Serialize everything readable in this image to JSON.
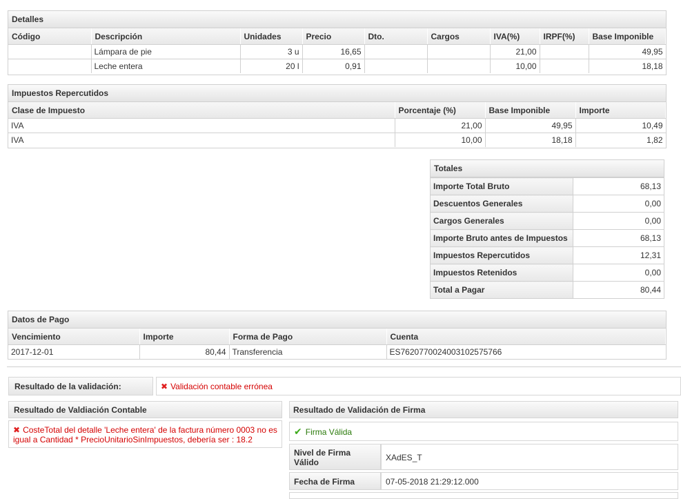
{
  "detalles": {
    "title": "Detalles",
    "columns": [
      "Código",
      "Descripción",
      "Unidades",
      "Precio",
      "Dto.",
      "Cargos",
      "IVA(%)",
      "IRPF(%)",
      "Base Imponible"
    ],
    "rows": [
      [
        "",
        "Lámpara de pie",
        "3 u",
        "16,65",
        "",
        "",
        "21,00",
        "",
        "49,95"
      ],
      [
        "",
        "Leche entera",
        "20 l",
        "0,91",
        "",
        "",
        "10,00",
        "",
        "18,18"
      ]
    ]
  },
  "impuestos": {
    "title": "Impuestos Repercutidos",
    "columns": [
      "Clase de Impuesto",
      "Porcentaje (%)",
      "Base Imponible",
      "Importe"
    ],
    "rows": [
      [
        "IVA",
        "21,00",
        "49,95",
        "10,49"
      ],
      [
        "IVA",
        "10,00",
        "18,18",
        "1,82"
      ]
    ]
  },
  "totales": {
    "title": "Totales",
    "rows": [
      {
        "label": "Importe Total Bruto",
        "value": "68,13"
      },
      {
        "label": "Descuentos Generales",
        "value": "0,00"
      },
      {
        "label": "Cargos Generales",
        "value": "0,00"
      },
      {
        "label": "Importe Bruto antes de Impuestos",
        "value": "68,13"
      },
      {
        "label": "Impuestos Repercutidos",
        "value": "12,31"
      },
      {
        "label": "Impuestos Retenidos",
        "value": "0,00"
      },
      {
        "label": "Total a Pagar",
        "value": "80,44"
      }
    ]
  },
  "pago": {
    "title": "Datos de Pago",
    "columns": [
      "Vencimiento",
      "Importe",
      "Forma de Pago",
      "Cuenta"
    ],
    "rows": [
      [
        "2017-12-01",
        "80,44",
        "Transferencia",
        "ES7620770024003102575766"
      ]
    ]
  },
  "validacion": {
    "label": "Resultado de la validación:",
    "result": "Validación contable errónea",
    "contable_title": "Resultado de Valdiación Contable",
    "contable_message": "CosteTotal del detalle 'Leche entera' de la factura número 0003 no es igual a Cantidad * PrecioUnitarioSinImpuestos, debería ser : 18.2",
    "firma_title": "Resultado de Validación de Firma",
    "firma_result": "Firma Válida",
    "nivel_label": "Nivel de Firma Válido",
    "nivel_value": "XAdES_T",
    "fecha_label": "Fecha de Firma",
    "fecha_value": "07-05-2018 21:29:12.000"
  },
  "colors": {
    "error": "#d40000",
    "ok": "#2a7a0a"
  }
}
